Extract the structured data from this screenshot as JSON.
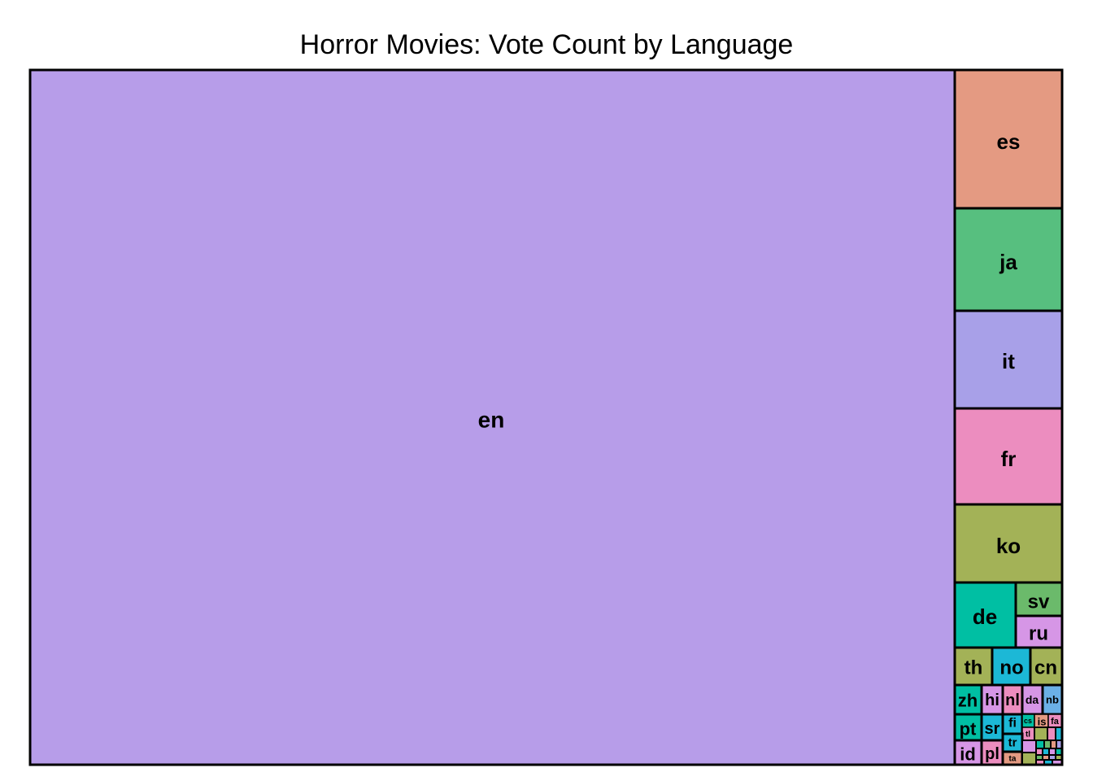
{
  "chart_data": {
    "type": "treemap",
    "title": "Horror Movies: Vote Count by Language",
    "tiles": [
      {
        "label": "en",
        "color": "#B79DE9"
      },
      {
        "label": "es",
        "color": "#E49A82"
      },
      {
        "label": "ja",
        "color": "#57BF7F"
      },
      {
        "label": "it",
        "color": "#A8A0E8"
      },
      {
        "label": "fr",
        "color": "#EC8DBF"
      },
      {
        "label": "ko",
        "color": "#A3B257"
      },
      {
        "label": "de",
        "color": "#00BFA3"
      },
      {
        "label": "sv",
        "color": "#6BBA6B"
      },
      {
        "label": "ru",
        "color": "#D696E6"
      },
      {
        "label": "th",
        "color": "#A3B257"
      },
      {
        "label": "no",
        "color": "#1CB8D6"
      },
      {
        "label": "cn",
        "color": "#A3B257"
      },
      {
        "label": "zh",
        "color": "#00BFA3"
      },
      {
        "label": "hi",
        "color": "#D696E6"
      },
      {
        "label": "nl",
        "color": "#EC8DBF"
      },
      {
        "label": "da",
        "color": "#D696E6"
      },
      {
        "label": "nb",
        "color": "#6BB0E6"
      },
      {
        "label": "pt",
        "color": "#00BFA3"
      },
      {
        "label": "sr",
        "color": "#1CB8D6"
      },
      {
        "label": "fi",
        "color": "#1CB8D6"
      },
      {
        "label": "cs",
        "color": "#00BFA3"
      },
      {
        "label": "is",
        "color": "#E49A82"
      },
      {
        "label": "fa",
        "color": "#EC8DBF"
      },
      {
        "label": "tl",
        "color": "#EC8DBF"
      },
      {
        "label": "id",
        "color": "#D696E6"
      },
      {
        "label": "pl",
        "color": "#EC8DBF"
      },
      {
        "label": "tr",
        "color": "#1CB8D6"
      },
      {
        "label": "ta",
        "color": "#E49A82"
      }
    ]
  }
}
